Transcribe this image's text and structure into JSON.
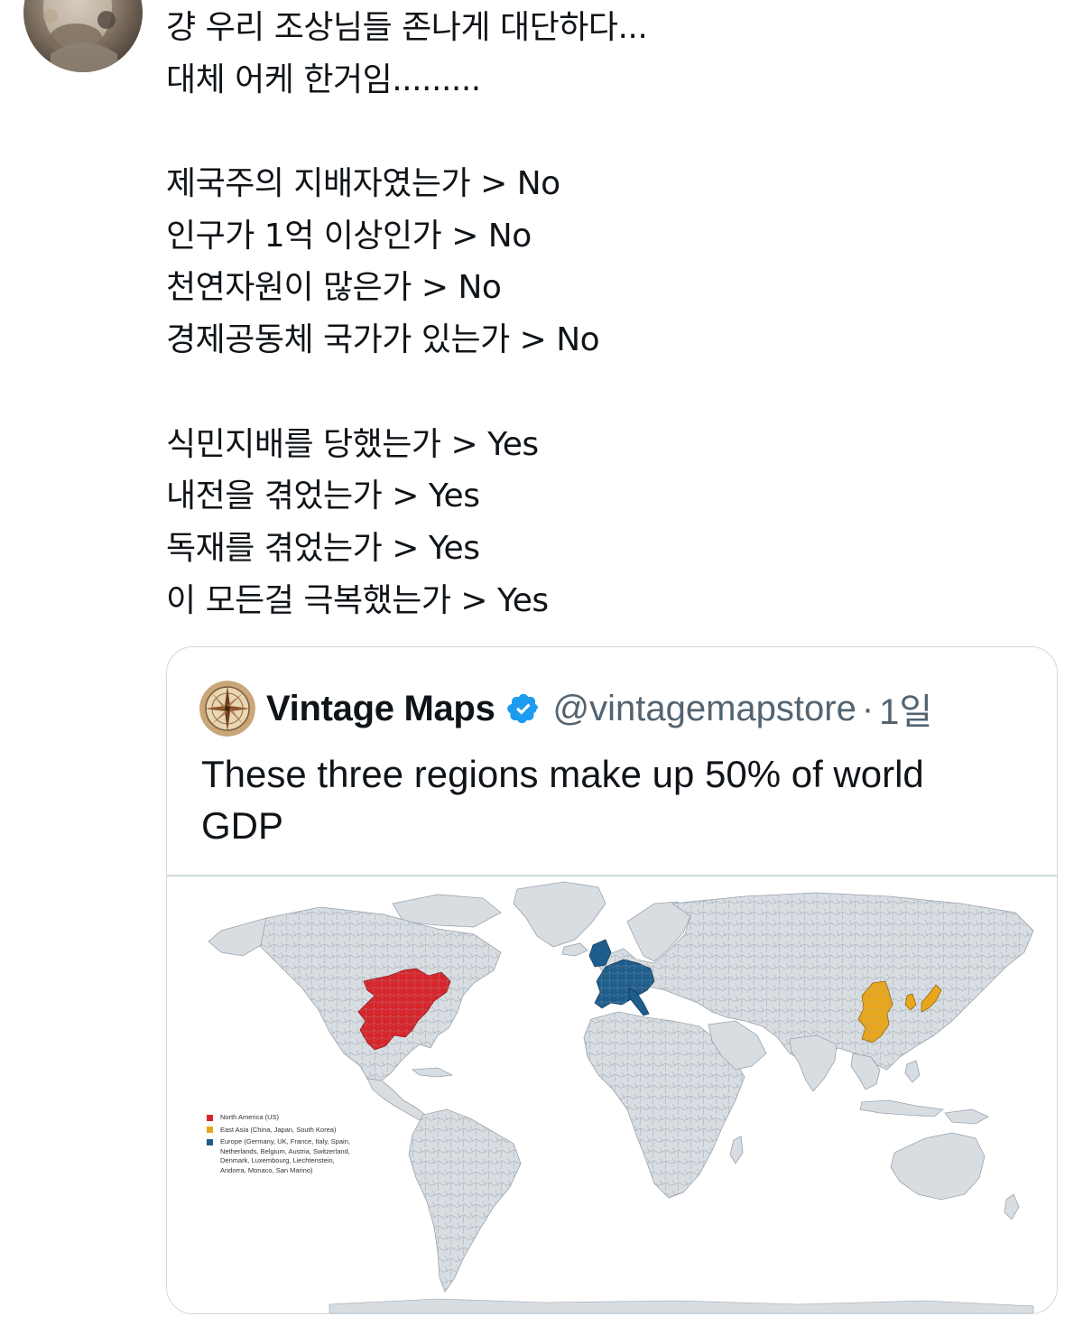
{
  "tweet": {
    "lines": [
      "걍 우리 조상님들 존나게 대단하다...",
      "대체 어케 한거임.........",
      "",
      "제국주의 지배자였는가 > No",
      "인구가 1억 이상인가 > No",
      "천연자원이 많은가 > No",
      "경제공동체 국가가 있는가 > No",
      "",
      "식민지배를 당했는가 > Yes",
      "내전을 겪었는가 > Yes",
      "독재를 겪었는가 > Yes",
      "이 모든걸 극복했는가 > Yes"
    ]
  },
  "quote": {
    "display_name": "Vintage Maps",
    "handle": "@vintagemapstore",
    "separator": "·",
    "time": "1일",
    "text": "These three regions make up 50% of world GDP",
    "verified_color": "#1d9bf0",
    "map": {
      "legend": [
        {
          "label": "North America (US)",
          "color": "#d7262b"
        },
        {
          "label": "East Asia (China, Japan, South Korea)",
          "color": "#e8a61c"
        },
        {
          "label": "Europe (Germany, UK, France, Italy, Spain, Netherlands, Belgium, Austria, Switzerland, Denmark, Luxembourg, Liechtenstein, Andorra, Monaco, San Marino)",
          "color": "#1f5d8c"
        }
      ],
      "land_color": "#d8dde2",
      "border_color": "#9aa3ab"
    }
  }
}
